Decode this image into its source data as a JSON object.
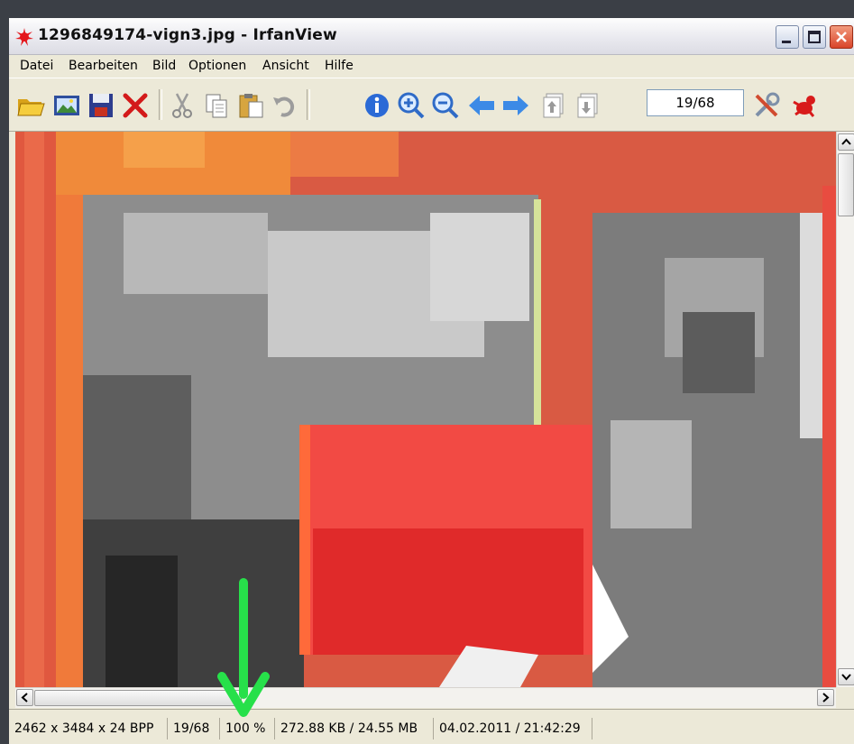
{
  "window": {
    "title": "1296849174-vign3.jpg - IrfanView",
    "buttons": [
      "minimize-icon",
      "maximize-icon",
      "close-icon"
    ]
  },
  "menu": {
    "items": [
      "Datei",
      "Bearbeiten",
      "Bild",
      "Optionen",
      "Ansicht",
      "Hilfe"
    ]
  },
  "toolbar": {
    "icons": [
      "open-folder-icon",
      "thumbnails-icon",
      "save-icon",
      "delete-icon",
      "cut-icon",
      "copy-icon",
      "paste-icon",
      "undo-icon",
      "info-icon",
      "zoom-in-icon",
      "zoom-out-icon",
      "previous-icon",
      "next-icon",
      "first-page-icon",
      "last-page-icon",
      "settings-icon",
      "irfanview-icon"
    ],
    "page_counter": "19/68"
  },
  "status": {
    "dimensions": "2462 x 3484 x 24 BPP",
    "position": "19/68",
    "zoom": "100 %",
    "size": "272.88 KB / 24.55 MB",
    "datetime": "04.02.2011 / 21:42:29"
  },
  "colors": {
    "overlay_arrow": "#27e04a",
    "image_orange": "#f08a3a",
    "image_red": "#f24a44",
    "image_gray": "#8e8e8e"
  }
}
